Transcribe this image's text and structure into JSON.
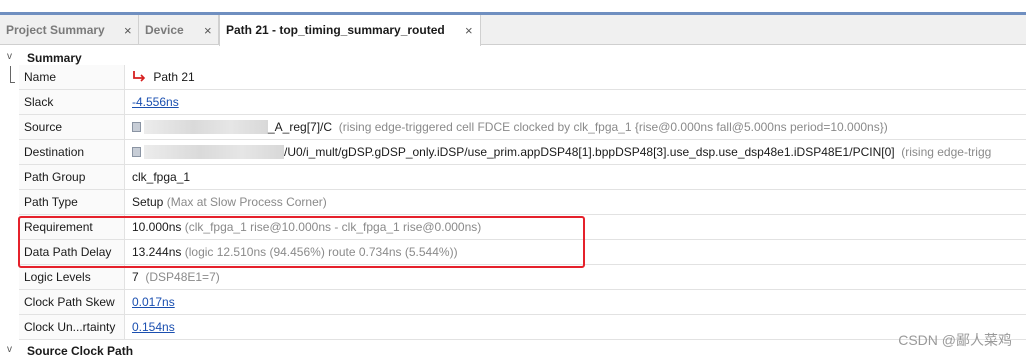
{
  "tabs": [
    {
      "label": "Project Summary",
      "close": "×",
      "active": false
    },
    {
      "label": "Device",
      "close": "×",
      "active": false
    },
    {
      "label": "Path 21 - top_timing_summary_routed",
      "close": "×",
      "active": true
    }
  ],
  "summary": {
    "section_title": "Summary",
    "chevron": "v",
    "rows": {
      "name": {
        "label": "Name",
        "value": "Path 21",
        "icon": "path-arrow-icon"
      },
      "slack": {
        "label": "Slack",
        "value": "-4.556ns"
      },
      "source": {
        "label": "Source",
        "value": "_A_reg[7]/C",
        "detail": "(rising edge-triggered cell FDCE clocked by clk_fpga_1  {rise@0.000ns fall@5.000ns period=10.000ns})",
        "icon": "cell-icon"
      },
      "destination": {
        "label": "Destination",
        "value": "/U0/i_mult/gDSP.gDSP_only.iDSP/use_prim.appDSP48[1].bppDSP48[3].use_dsp.use_dsp48e1.iDSP48E1/PCIN[0]",
        "detail": "(rising edge-trigg",
        "icon": "cell-icon"
      },
      "path_group": {
        "label": "Path Group",
        "value": "clk_fpga_1"
      },
      "path_type": {
        "label": "Path Type",
        "value": "Setup",
        "detail": "(Max at Slow Process Corner)"
      },
      "requirement": {
        "label": "Requirement",
        "value": "10.000ns",
        "detail": "(clk_fpga_1 rise@10.000ns - clk_fpga_1 rise@0.000ns)"
      },
      "data_path_delay": {
        "label": "Data Path Delay",
        "value": "13.244ns",
        "detail": "(logic 12.510ns (94.456%)  route 0.734ns (5.544%))"
      },
      "logic_levels": {
        "label": "Logic Levels",
        "value": "7",
        "detail": "(DSP48E1=7)"
      },
      "clock_path_skew": {
        "label": "Clock Path Skew",
        "value": "0.017ns"
      },
      "clock_uncertainty": {
        "label": "Clock Un...rtainty",
        "value": "0.154ns"
      }
    }
  },
  "source_clock_path": {
    "section_title": "Source Clock Path",
    "chevron": "v"
  },
  "watermark": "CSDN @鄙人菜鸡",
  "colors": {
    "accent": "#6f8fc0",
    "highlight": "#e5212b",
    "link": "#1a4fb0",
    "path_icon": "#d62020"
  }
}
